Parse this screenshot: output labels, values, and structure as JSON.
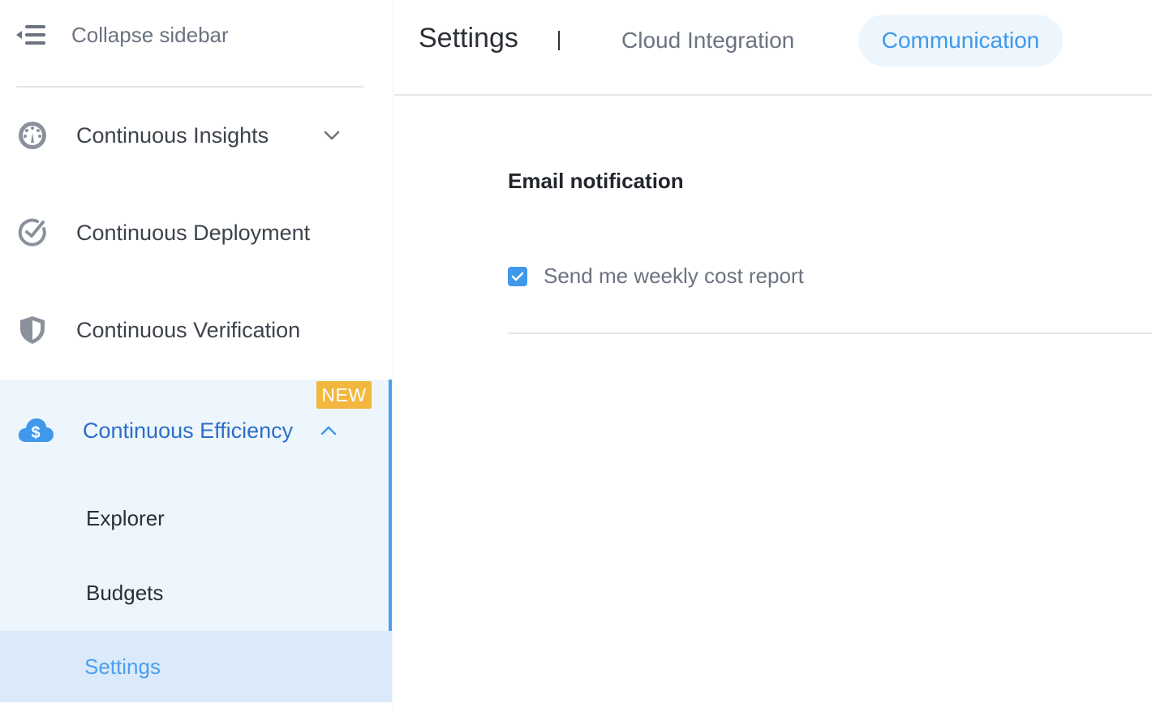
{
  "sidebar": {
    "collapse_label": "Collapse sidebar",
    "items": [
      {
        "label": "Continuous Insights",
        "icon": "dashboard-gauge-icon",
        "expandable": true,
        "expanded": false
      },
      {
        "label": "Continuous Deployment",
        "icon": "deployment-check-icon"
      },
      {
        "label": "Continuous Verification",
        "icon": "shield-icon"
      },
      {
        "label": "Continuous Efficiency",
        "icon": "cloud-dollar-icon",
        "badge": "NEW",
        "expandable": true,
        "expanded": true,
        "active": true,
        "subitems": [
          {
            "label": "Explorer"
          },
          {
            "label": "Budgets"
          },
          {
            "label": "Settings",
            "selected": true
          }
        ]
      }
    ]
  },
  "header": {
    "title": "Settings",
    "tabs": [
      {
        "label": "Cloud Integration",
        "active": false
      },
      {
        "label": "Communication",
        "active": true
      }
    ]
  },
  "main": {
    "section_title": "Email notification",
    "options": [
      {
        "label": "Send me weekly cost report",
        "checked": true
      }
    ]
  },
  "colors": {
    "accent": "#3f98ea",
    "active_bg": "#eef6fd",
    "selected_bg": "#dbeafa",
    "badge": "#f3b73f"
  }
}
